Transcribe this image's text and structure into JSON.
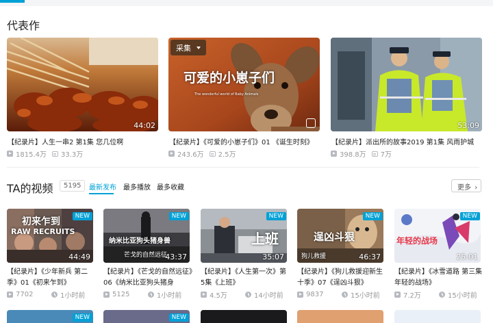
{
  "featured": {
    "title": "代表作",
    "items": [
      {
        "duration": "44:02",
        "title": "【纪录片】人生一串2 第1集 您几位啊",
        "views": "1815.4万",
        "danmaku": "33.3万"
      },
      {
        "duration": "",
        "collect_label": "采集",
        "thumb_text": "可爱的小崽子们",
        "thumb_sub": "The wonderful world of Baby Animals",
        "title": "【纪录片】《可爱的小崽子们》01 《诞生时刻》",
        "views": "243.6万",
        "danmaku": "2.5万"
      },
      {
        "duration": "53:09",
        "title": "【纪录片】派出所的故事2019 第1集 风雨护城",
        "views": "398.8万",
        "danmaku": "7万"
      }
    ]
  },
  "videos_section": {
    "title": "TA的视频",
    "count": "5195",
    "tabs": [
      "最新发布",
      "最多播放",
      "最多收藏"
    ],
    "more_label": "更多",
    "new_label": "NEW"
  },
  "videos": [
    {
      "duration": "44:49",
      "thumb_text": "初来乍到",
      "thumb_sub": "RAW RECRUITS",
      "title": "【纪录片】《少年新兵 第二季》01《初来乍到》",
      "views": "7702",
      "time": "1小时前"
    },
    {
      "duration": "43:37",
      "thumb_text": "纳米比亚狗头猪身兽",
      "thumb_sub": "芒戈的自然远征",
      "title": "【纪录片】《芒戈的自然远征》06《纳米比亚狗头猪身",
      "views": "5125",
      "time": "1小时前"
    },
    {
      "duration": "35:07",
      "thumb_text": "上班",
      "title": "【纪录片】《人生第一次》第5集《上班》",
      "views": "4.5万",
      "time": "14小时前"
    },
    {
      "duration": "46:37",
      "thumb_text": "逞凶斗狠",
      "thumb_sub": "狗儿救援",
      "title": "【纪录片】《狗儿救援迎新生十季》07《逞凶斗狠》",
      "views": "9837",
      "time": "15小时前"
    },
    {
      "duration": "25:01",
      "thumb_text": "年轻的战场",
      "title": "【纪录片】《冰雪道路 第三集 年轻的战场》",
      "views": "7.2万",
      "time": "15小时前"
    }
  ]
}
